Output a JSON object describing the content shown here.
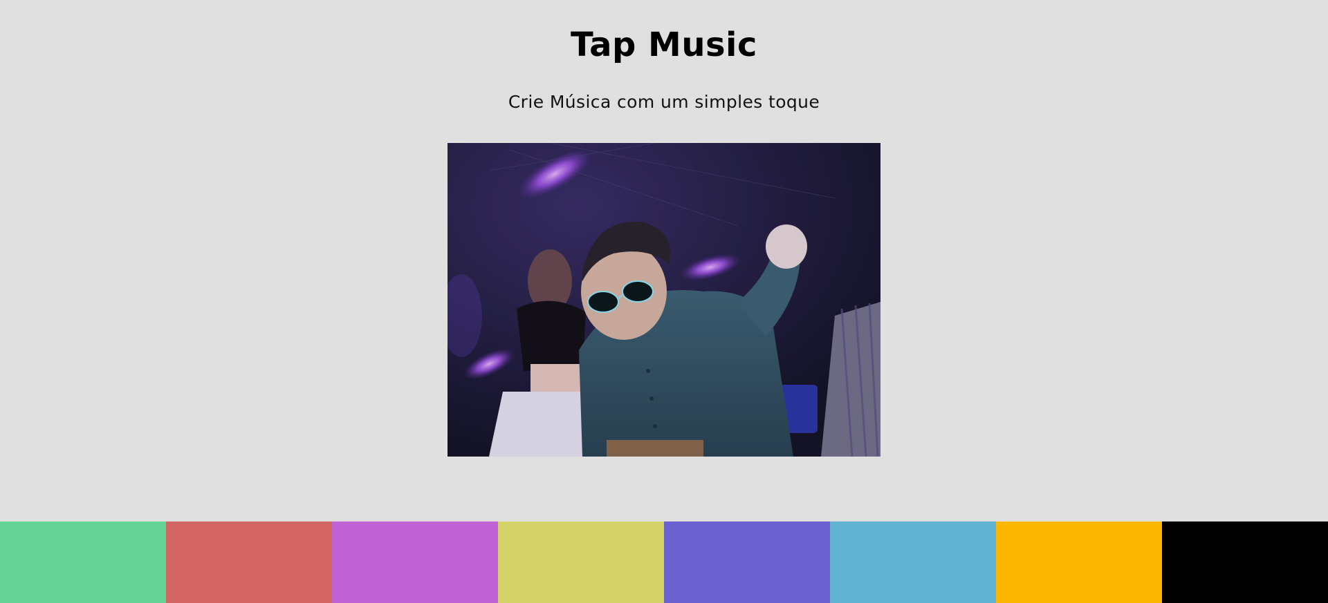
{
  "header": {
    "title": "Tap Music",
    "subtitle": "Crie Música com um simples toque"
  },
  "media": {
    "alt": "gif of boy with sunglasses dancing at a party"
  },
  "pads": [
    {
      "name": "pad-1",
      "color": "#64d395"
    },
    {
      "name": "pad-2",
      "color": "#d46461"
    },
    {
      "name": "pad-3",
      "color": "#c064d5"
    },
    {
      "name": "pad-4",
      "color": "#d4d268"
    },
    {
      "name": "pad-5",
      "color": "#6c61d1"
    },
    {
      "name": "pad-6",
      "color": "#62b2d4"
    },
    {
      "name": "pad-7",
      "color": "#feb700"
    },
    {
      "name": "pad-8",
      "color": "#000000"
    }
  ]
}
